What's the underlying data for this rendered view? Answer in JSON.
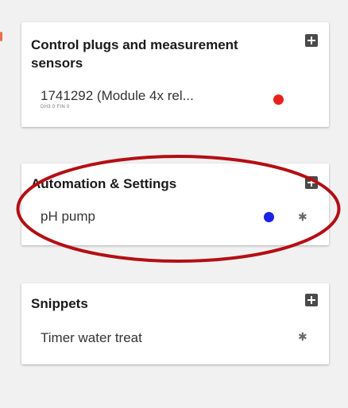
{
  "cards": {
    "control": {
      "title": "Control plugs and measurement sensors",
      "item": {
        "label": "1741292 (Module 4x rel...",
        "sublabel": "DH3 0 FIN 0",
        "status_color": "#e8221a",
        "status_icon": "red-status-dot"
      },
      "add_icon": "add-box-icon"
    },
    "automation": {
      "title": "Automation & Settings",
      "item": {
        "label": "pH pump",
        "status_color": "#1a22e8",
        "status_icon": "blue-status-dot",
        "settings_icon": "gear-icon"
      },
      "add_icon": "add-box-icon"
    },
    "snippets": {
      "title": "Snippets",
      "item": {
        "label": "Timer water treat",
        "settings_icon": "gear-icon"
      },
      "add_icon": "add-box-icon"
    }
  },
  "annotation": {
    "highlight_color": "#b30f14",
    "shape": "ellipse"
  },
  "glyphs": {
    "gear": "✱"
  }
}
